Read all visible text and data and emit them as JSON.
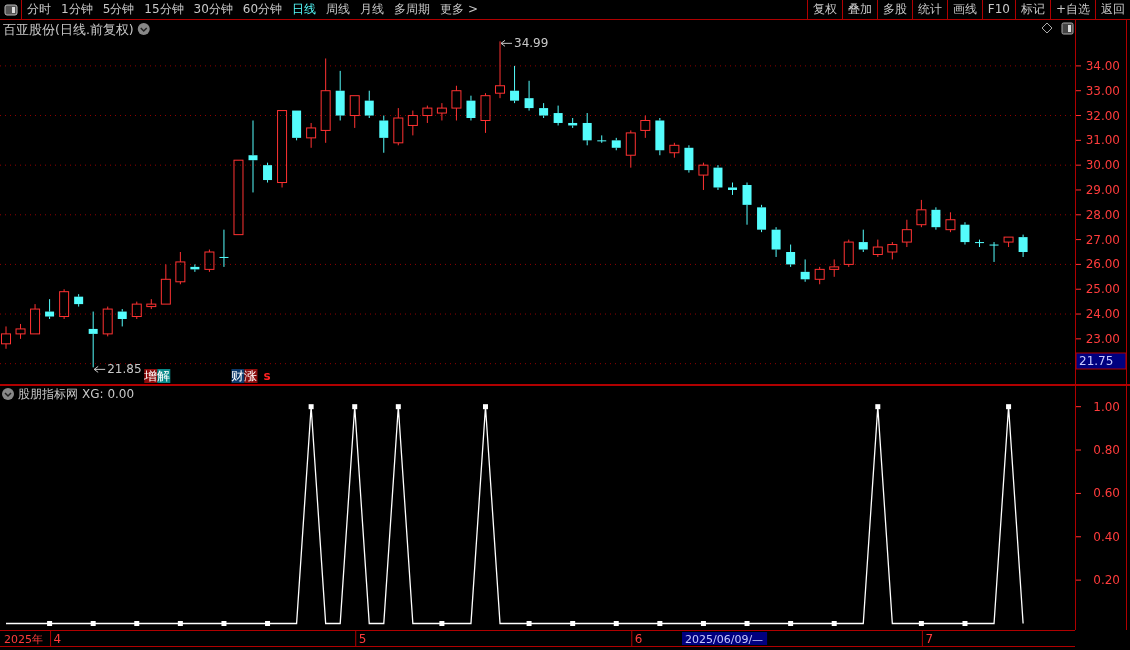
{
  "toolbar": {
    "tabs": [
      {
        "label": "分时",
        "selected": false
      },
      {
        "label": "1分钟",
        "selected": false
      },
      {
        "label": "5分钟",
        "selected": false
      },
      {
        "label": "15分钟",
        "selected": false
      },
      {
        "label": "30分钟",
        "selected": false
      },
      {
        "label": "60分钟",
        "selected": false
      },
      {
        "label": "日线",
        "selected": true
      },
      {
        "label": "周线",
        "selected": false
      },
      {
        "label": "月线",
        "selected": false
      },
      {
        "label": "多周期",
        "selected": false
      },
      {
        "label": "更多 >",
        "selected": false
      }
    ],
    "buttons": [
      "复权",
      "叠加",
      "多股",
      "统计",
      "画线",
      "F10",
      "标记",
      "+自选",
      "返回"
    ]
  },
  "main_chart": {
    "title": "百亚股份(日线.前复权)",
    "price_marker": "21.75",
    "chart_data": {
      "type": "candlestick",
      "categories": [
        null,
        null,
        null,
        null,
        null,
        null,
        null,
        null,
        null,
        null,
        null,
        null,
        null,
        null,
        null,
        null,
        null,
        null,
        null,
        null,
        null,
        null,
        null,
        null,
        null,
        null,
        null,
        null,
        null,
        null,
        null,
        null,
        null,
        null,
        null,
        null,
        null,
        null,
        null,
        null,
        null,
        null,
        null,
        null,
        null,
        null,
        null,
        null,
        null,
        null,
        null,
        null,
        null,
        null,
        null,
        null,
        null,
        null,
        null,
        null,
        null,
        null,
        null,
        null,
        null,
        null,
        null,
        null,
        null,
        null,
        null
      ],
      "ohlc": [
        [
          22.8,
          23.5,
          22.6,
          23.2
        ],
        [
          23.2,
          23.6,
          23.0,
          23.4
        ],
        [
          23.2,
          24.4,
          23.2,
          24.2
        ],
        [
          24.1,
          24.6,
          23.8,
          23.9
        ],
        [
          23.9,
          25.0,
          23.8,
          24.9
        ],
        [
          24.7,
          24.8,
          24.3,
          24.4
        ],
        [
          23.4,
          24.1,
          21.85,
          23.2
        ],
        [
          23.2,
          24.3,
          23.1,
          24.2
        ],
        [
          24.1,
          24.2,
          23.5,
          23.8
        ],
        [
          23.9,
          24.5,
          23.8,
          24.4
        ],
        [
          24.3,
          24.6,
          24.2,
          24.4
        ],
        [
          24.4,
          26.0,
          24.4,
          25.4
        ],
        [
          25.3,
          26.5,
          25.2,
          26.1
        ],
        [
          25.9,
          26.0,
          25.7,
          25.8
        ],
        [
          25.8,
          26.6,
          25.7,
          26.5
        ],
        [
          26.3,
          27.4,
          25.9,
          26.3
        ],
        [
          27.2,
          30.2,
          27.2,
          30.2
        ],
        [
          30.4,
          31.8,
          28.9,
          30.2
        ],
        [
          30.0,
          30.1,
          29.3,
          29.4
        ],
        [
          29.3,
          32.2,
          29.1,
          32.2
        ],
        [
          32.2,
          32.2,
          31.0,
          31.1
        ],
        [
          31.1,
          31.7,
          30.7,
          31.5
        ],
        [
          31.4,
          34.3,
          30.9,
          33.0
        ],
        [
          33.0,
          33.8,
          31.8,
          32.0
        ],
        [
          32.0,
          32.8,
          31.5,
          32.8
        ],
        [
          32.6,
          33.0,
          31.9,
          32.0
        ],
        [
          31.8,
          32.0,
          30.5,
          31.1
        ],
        [
          30.9,
          32.3,
          30.8,
          31.9
        ],
        [
          31.6,
          32.2,
          31.2,
          32.0
        ],
        [
          32.0,
          32.4,
          31.7,
          32.3
        ],
        [
          32.1,
          32.5,
          31.8,
          32.3
        ],
        [
          32.3,
          33.2,
          31.8,
          33.0
        ],
        [
          32.6,
          32.8,
          31.8,
          31.9
        ],
        [
          31.8,
          32.9,
          31.3,
          32.8
        ],
        [
          32.9,
          34.99,
          32.7,
          33.2
        ],
        [
          33.0,
          34.0,
          32.5,
          32.6
        ],
        [
          32.7,
          33.4,
          32.2,
          32.3
        ],
        [
          32.3,
          32.5,
          31.9,
          32.0
        ],
        [
          32.1,
          32.4,
          31.6,
          31.7
        ],
        [
          31.7,
          31.9,
          31.5,
          31.6
        ],
        [
          31.7,
          32.1,
          30.8,
          31.0
        ],
        [
          31.0,
          31.2,
          30.9,
          31.0
        ],
        [
          31.0,
          31.1,
          30.6,
          30.7
        ],
        [
          30.4,
          31.4,
          29.9,
          31.3
        ],
        [
          31.4,
          32.0,
          31.1,
          31.8
        ],
        [
          31.8,
          31.9,
          30.4,
          30.6
        ],
        [
          30.5,
          30.9,
          30.3,
          30.8
        ],
        [
          30.7,
          30.8,
          29.7,
          29.8
        ],
        [
          29.6,
          30.1,
          29.0,
          30.0
        ],
        [
          29.9,
          30.0,
          29.0,
          29.1
        ],
        [
          29.1,
          29.3,
          28.8,
          29.0
        ],
        [
          29.2,
          29.3,
          27.6,
          28.4
        ],
        [
          28.3,
          28.4,
          27.3,
          27.4
        ],
        [
          27.4,
          27.5,
          26.3,
          26.6
        ],
        [
          26.5,
          26.8,
          25.9,
          26.0
        ],
        [
          25.7,
          26.2,
          25.3,
          25.4
        ],
        [
          25.4,
          25.9,
          25.2,
          25.8
        ],
        [
          25.8,
          26.2,
          25.5,
          25.9
        ],
        [
          26.0,
          27.0,
          25.9,
          26.9
        ],
        [
          26.9,
          27.4,
          26.5,
          26.6
        ],
        [
          26.4,
          27.0,
          26.3,
          26.7
        ],
        [
          26.5,
          26.9,
          26.2,
          26.8
        ],
        [
          26.9,
          27.8,
          26.7,
          27.4
        ],
        [
          27.6,
          28.6,
          27.5,
          28.2
        ],
        [
          28.2,
          28.3,
          27.4,
          27.5
        ],
        [
          27.4,
          28.1,
          27.3,
          27.8
        ],
        [
          27.6,
          27.7,
          26.8,
          26.9
        ],
        [
          26.9,
          27.0,
          26.7,
          26.9
        ],
        [
          26.8,
          26.9,
          26.1,
          26.8
        ],
        [
          26.9,
          27.1,
          26.7,
          27.1
        ],
        [
          27.1,
          27.2,
          26.3,
          26.5
        ]
      ],
      "ylim": [
        21.14,
        35.85
      ],
      "yticks": [
        {
          "value": 34,
          "label": "34.00"
        },
        {
          "value": 33,
          "label": "33.00"
        },
        {
          "value": 32,
          "label": "32.00"
        },
        {
          "value": 31,
          "label": "31.00"
        },
        {
          "value": 30,
          "label": "30.00"
        },
        {
          "value": 29,
          "label": "29.00"
        },
        {
          "value": 28,
          "label": "28.00"
        },
        {
          "value": 27,
          "label": "27.00"
        },
        {
          "value": 26,
          "label": "26.00"
        },
        {
          "value": 25,
          "label": "25.00"
        },
        {
          "value": 24,
          "label": "24.00"
        },
        {
          "value": 23,
          "label": "23.00"
        }
      ],
      "annotations": [
        {
          "text": "34.99"
        },
        {
          "text": "21.85"
        }
      ],
      "grid": true
    },
    "events": [
      {
        "text": "增解"
      },
      {
        "text": "财涨"
      },
      {
        "text": "s"
      }
    ]
  },
  "indicator": {
    "title": "股朋指标网",
    "readout": "XG: 0.00",
    "chart_data": {
      "type": "line",
      "categories": [
        null,
        null,
        null,
        null,
        null,
        null,
        null,
        null,
        null,
        null,
        null,
        null,
        null,
        null,
        null,
        null,
        null,
        null,
        null,
        null,
        null,
        null,
        null,
        null,
        null,
        null,
        null,
        null,
        null,
        null,
        null,
        null,
        null,
        null,
        null,
        null,
        null,
        null,
        null,
        null,
        null,
        null,
        null,
        null,
        null,
        null,
        null,
        null,
        null,
        null,
        null,
        null,
        null,
        null,
        null,
        null,
        null,
        null,
        null,
        null,
        null,
        null,
        null,
        null,
        null,
        null,
        null,
        null,
        null,
        null,
        null
      ],
      "ylim": [
        -0.03,
        1.1
      ],
      "series": [
        {
          "color": "#ffffff",
          "values": [
            0,
            0,
            0,
            0,
            0,
            0,
            0,
            0,
            0,
            0,
            0,
            0,
            0,
            0,
            0,
            0,
            0,
            0,
            0,
            0,
            0,
            1,
            0,
            0,
            1,
            0,
            0,
            1,
            0,
            0,
            0,
            0,
            0,
            1,
            0,
            0,
            0,
            0,
            0,
            0,
            0,
            0,
            0,
            0,
            0,
            0,
            0,
            0,
            0,
            0,
            0,
            0,
            0,
            0,
            0,
            0,
            0,
            0,
            0,
            0,
            1,
            0,
            0,
            0,
            0,
            0,
            0,
            0,
            0,
            1,
            0
          ]
        }
      ],
      "yticks": [
        {
          "value": 1,
          "label": "1.00"
        },
        {
          "value": 0.8,
          "label": "0.80"
        },
        {
          "value": 0.6,
          "label": "0.60"
        },
        {
          "value": 0.4,
          "label": "0.40"
        },
        {
          "value": 0.2,
          "label": "0.20"
        }
      ]
    }
  },
  "date_axis": {
    "year_label": "2025年",
    "months": [
      "4",
      "5",
      "6",
      "7"
    ],
    "cursor_label": "2025/06/09/—"
  }
}
